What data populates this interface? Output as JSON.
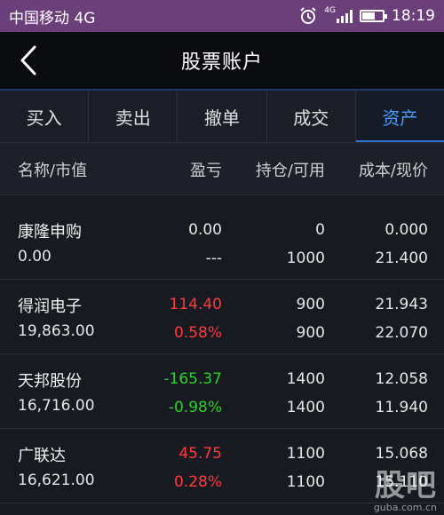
{
  "status_bar": {
    "carrier": "中国移动 4G",
    "network": "4G",
    "time": "18:19"
  },
  "header": {
    "title": "股票账户"
  },
  "tabs": [
    {
      "label": "买入",
      "active": false
    },
    {
      "label": "卖出",
      "active": false
    },
    {
      "label": "撤单",
      "active": false
    },
    {
      "label": "成交",
      "active": false
    },
    {
      "label": "资产",
      "active": true
    }
  ],
  "columns": {
    "name_mv": "名称/市值",
    "pl": "盈亏",
    "hold_avail": "持仓/可用",
    "cost_price": "成本/现价"
  },
  "colors": {
    "up": "#ff3b3b",
    "down": "#2bd12b",
    "accent": "#4a9cff"
  },
  "holdings": [
    {
      "name": "康隆申购",
      "market_value": "0.00",
      "pl": "0.00",
      "pl_pct": "---",
      "hold": "0",
      "avail": "1000",
      "cost": "0.000",
      "price": "21.400",
      "trend": "neutral"
    },
    {
      "name": "得润电子",
      "market_value": "19,863.00",
      "pl": "114.40",
      "pl_pct": "0.58%",
      "hold": "900",
      "avail": "900",
      "cost": "21.943",
      "price": "22.070",
      "trend": "up"
    },
    {
      "name": "天邦股份",
      "market_value": "16,716.00",
      "pl": "-165.37",
      "pl_pct": "-0.98%",
      "hold": "1400",
      "avail": "1400",
      "cost": "12.058",
      "price": "11.940",
      "trend": "down"
    },
    {
      "name": "广联达",
      "market_value": "16,621.00",
      "pl": "45.75",
      "pl_pct": "0.28%",
      "hold": "1100",
      "avail": "1100",
      "cost": "15.068",
      "price": "15.110",
      "trend": "up"
    }
  ],
  "watermark": {
    "logo": "股吧",
    "url": "guba.com.cn"
  }
}
